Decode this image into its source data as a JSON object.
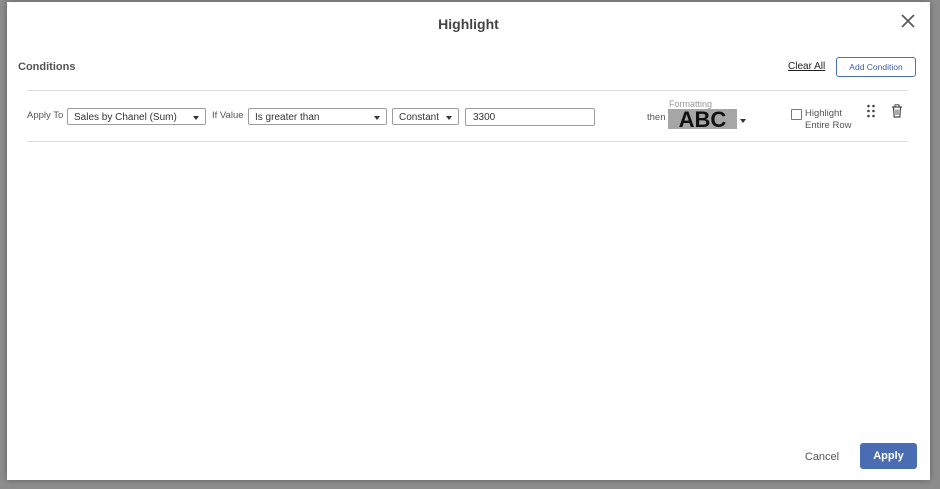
{
  "dialog": {
    "title": "Highlight"
  },
  "header": {
    "conditions_label": "Conditions",
    "clear_all": "Clear All",
    "add_condition": "Add Condition"
  },
  "condition": {
    "apply_to_label": "Apply To",
    "apply_to_value": "Sales by Chanel (Sum)",
    "if_value_label": "If Value",
    "operator_value": "Is greater than",
    "compare_type_value": "Constant",
    "value": "3300",
    "then_label": "then",
    "formatting_label": "Formatting",
    "formatting_preview": "ABC",
    "highlight_line1": "Highlight",
    "highlight_line2": "Entire Row",
    "highlight_checked": false
  },
  "footer": {
    "cancel": "Cancel",
    "apply": "Apply"
  },
  "colors": {
    "accent": "#4a6cb3",
    "swatch_background": "#a6a6a6",
    "overlay": "#8d8d8d"
  }
}
